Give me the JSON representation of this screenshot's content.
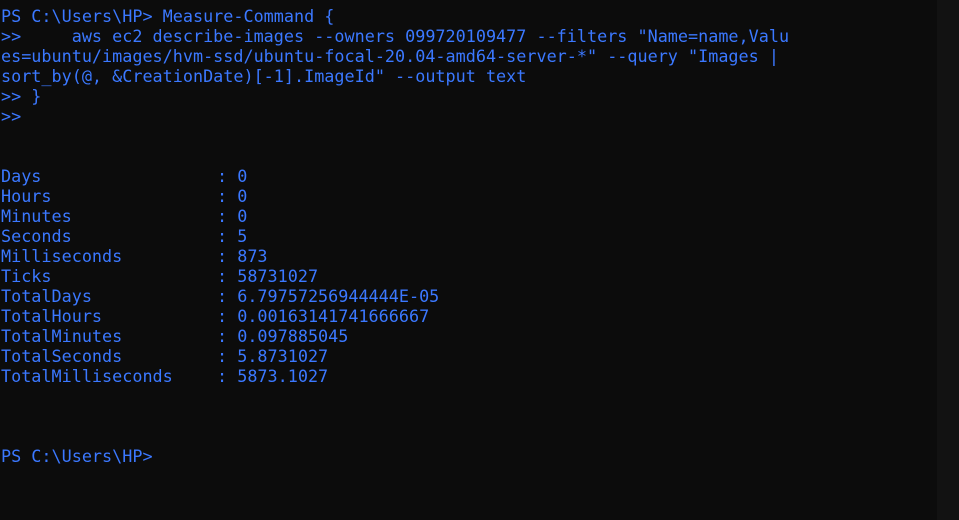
{
  "command": {
    "line1": "PS C:\\Users\\HP> Measure-Command {",
    "line2": ">>     aws ec2 describe-images --owners 099720109477 --filters \"Name=name,Valu",
    "line3": "es=ubuntu/images/hvm-ssd/ubuntu-focal-20.04-amd64-server-*\" --query \"Images |",
    "line4": "sort_by(@, &CreationDate)[-1].ImageId\" --output text",
    "line5": ">> }",
    "line6": ">>"
  },
  "results": [
    {
      "name": "Days",
      "value": "0"
    },
    {
      "name": "Hours",
      "value": "0"
    },
    {
      "name": "Minutes",
      "value": "0"
    },
    {
      "name": "Seconds",
      "value": "5"
    },
    {
      "name": "Milliseconds",
      "value": "873"
    },
    {
      "name": "Ticks",
      "value": "58731027"
    },
    {
      "name": "TotalDays",
      "value": "6.79757256944444E-05"
    },
    {
      "name": "TotalHours",
      "value": "0.00163141741666667"
    },
    {
      "name": "TotalMinutes",
      "value": "0.097885045"
    },
    {
      "name": "TotalSeconds",
      "value": "5.8731027"
    },
    {
      "name": "TotalMilliseconds",
      "value": "5873.1027"
    }
  ],
  "separator": ": ",
  "prompt": "PS C:\\Users\\HP>",
  "colors": {
    "background": "#0c0c0c",
    "text": "#3b78ff"
  }
}
